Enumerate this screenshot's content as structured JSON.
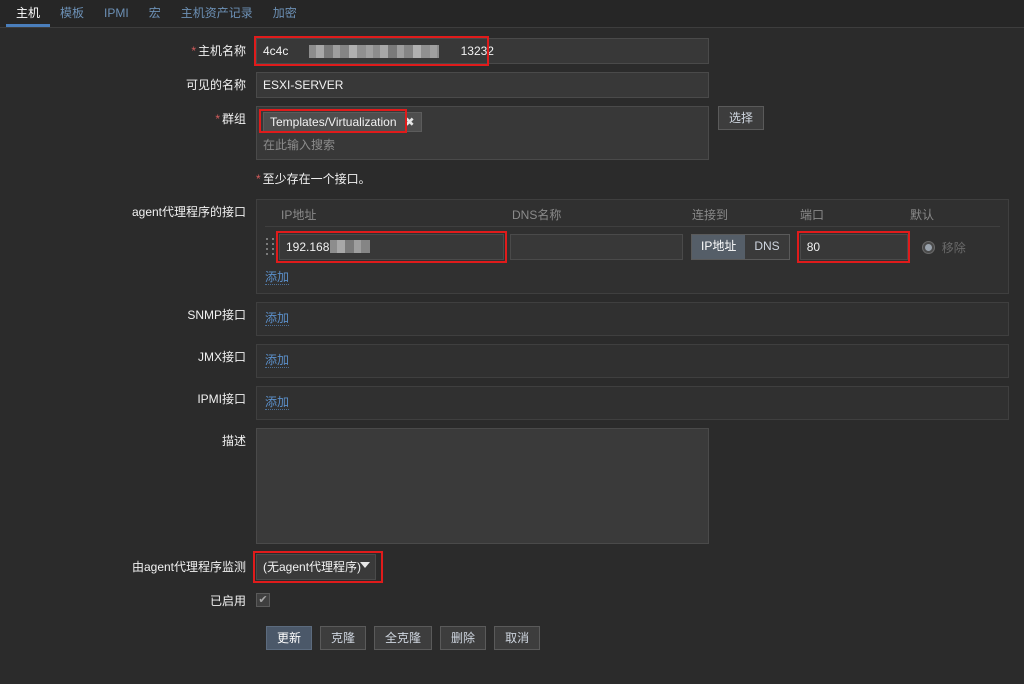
{
  "tabs": [
    {
      "label": "主机",
      "active": true
    },
    {
      "label": "模板",
      "active": false
    },
    {
      "label": "IPMI",
      "active": false
    },
    {
      "label": "宏",
      "active": false
    },
    {
      "label": "主机资产记录",
      "active": false
    },
    {
      "label": "加密",
      "active": false
    }
  ],
  "form": {
    "hostname": {
      "label": "主机名称",
      "required": true,
      "value_prefix": "4c4c",
      "value_suffix": "13232"
    },
    "visible_name": {
      "label": "可见的名称",
      "value": "ESXI-SERVER"
    },
    "groups": {
      "label": "群组",
      "required": true,
      "chip": "Templates/Virtualization",
      "chip_remove": "✖",
      "placeholder": "在此输入搜索",
      "select_button": "选择"
    },
    "interface_note": "至少存在一个接口。",
    "agent_interface": {
      "label": "agent代理程序的接口",
      "headers": {
        "ip": "IP地址",
        "dns": "DNS名称",
        "connect_to": "连接到",
        "port": "端口",
        "default": "默认"
      },
      "row": {
        "ip_value": "192.168",
        "dns_value": "",
        "connect_ip": "IP地址",
        "connect_dns": "DNS",
        "connect_selected": "IP地址",
        "port_value": "80",
        "remove_label": "移除"
      },
      "add_label": "添加"
    },
    "snmp_interface": {
      "label": "SNMP接口",
      "add_label": "添加"
    },
    "jmx_interface": {
      "label": "JMX接口",
      "add_label": "添加"
    },
    "ipmi_interface": {
      "label": "IPMI接口",
      "add_label": "添加"
    },
    "description": {
      "label": "描述",
      "value": ""
    },
    "monitored_by": {
      "label": "由agent代理程序监测",
      "selected": "(无agent代理程序)"
    },
    "enabled": {
      "label": "已启用",
      "checked": true,
      "check_glyph": "✔"
    }
  },
  "buttons": {
    "update": "更新",
    "clone": "克隆",
    "full_clone": "全克隆",
    "delete": "删除",
    "cancel": "取消"
  },
  "colors": {
    "accent_blue": "#5b8fc9",
    "tab_active_underline": "#4a7ebb",
    "required_red": "#d45c5c",
    "annotation_red": "#e01b1b",
    "page_bg": "#2b2b2b",
    "input_bg": "#383838"
  }
}
